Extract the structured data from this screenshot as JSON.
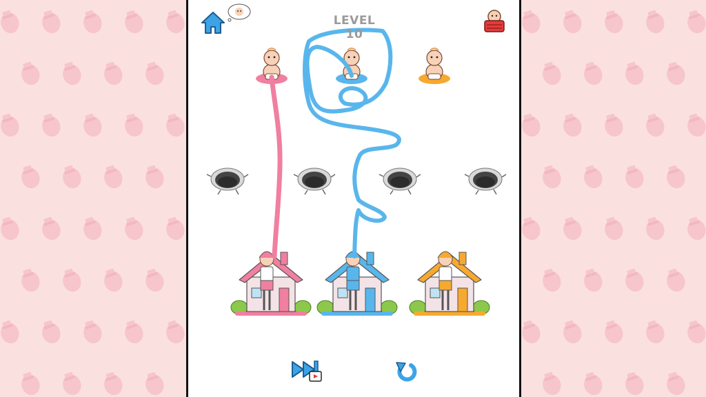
{
  "header": {
    "level_label": "LEVEL 10"
  },
  "icons": {
    "home": "home-icon",
    "hint_baby": "thought-baby-icon",
    "baby_basket": "baby-basket-icon",
    "skip": "skip-video-icon",
    "restart": "restart-icon"
  },
  "colors": {
    "background": "#fbe0e0",
    "pink": "#f07fa0",
    "blue": "#59b6ec",
    "orange": "#f7a92f",
    "panel": "#ffffff"
  },
  "babies": [
    {
      "name": "pink-baby",
      "color": "pink"
    },
    {
      "name": "blue-baby",
      "color": "blue"
    },
    {
      "name": "orange-baby",
      "color": "orange"
    }
  ],
  "houses": [
    {
      "name": "pink-house",
      "color": "pink",
      "parent": "mother"
    },
    {
      "name": "blue-house",
      "color": "blue",
      "parent": "father"
    },
    {
      "name": "orange-house",
      "color": "orange",
      "parent": "mother"
    }
  ],
  "holes": 4
}
